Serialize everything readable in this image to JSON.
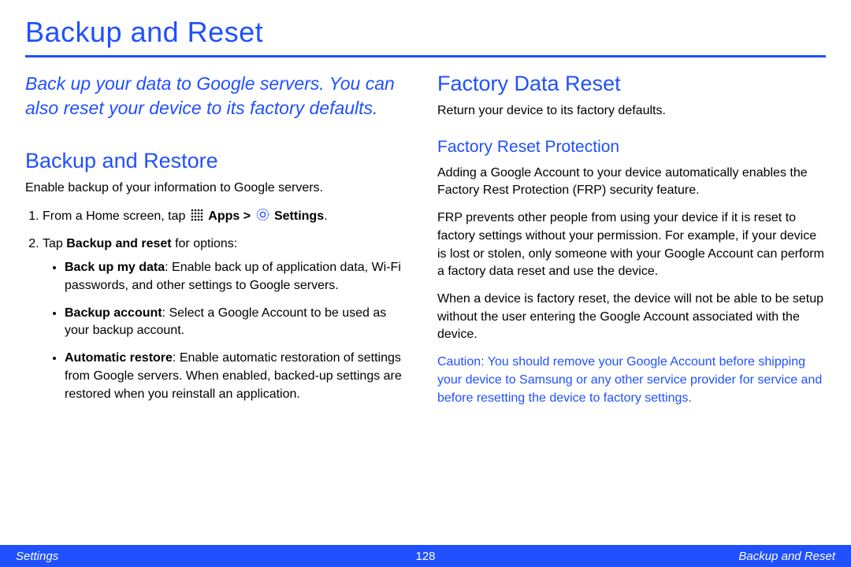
{
  "title": "Backup and Reset",
  "lead": "Back up your data to Google servers. You can also reset your device to its factory defaults.",
  "left": {
    "heading": "Backup and Restore",
    "intro": "Enable backup of your information to Google servers.",
    "step1_prefix": "From a Home screen, tap ",
    "step1_apps": "Apps",
    "step1_gt": " > ",
    "step1_settings": "Settings",
    "step1_suffix": ".",
    "step2_prefix": "Tap ",
    "step2_bold": "Backup and reset",
    "step2_suffix": " for options:",
    "opt1_bold": "Back up my data",
    "opt1_rest": ": Enable back up of application data, Wi-Fi passwords, and other settings to Google servers.",
    "opt2_bold": "Backup account",
    "opt2_rest": ": Select a Google Account to be used as your backup account.",
    "opt3_bold": "Automatic restore",
    "opt3_rest": ": Enable automatic restoration of settings from Google servers. When enabled, backed-up settings are restored when you reinstall an application."
  },
  "right": {
    "heading": "Factory Data Reset",
    "intro": "Return your device to its factory defaults.",
    "sub": "Factory Reset Protection",
    "p1": "Adding a Google Account to your device automatically enables the Factory Rest Protection (FRP) security feature.",
    "p2": "FRP prevents other people from using your device if it is reset to factory settings without your permission. For example, if your device is lost or stolen, only someone with your Google Account can perform a factory data reset and use the device.",
    "p3": "When a device is factory reset, the device will not be able to be setup without the user entering the Google Account associated with the device.",
    "caution_label": "Caution",
    "caution_rest": ": You should remove your Google Account before shipping your device to Samsung or any other service provider for service and before resetting the device to factory settings."
  },
  "footer": {
    "left": "Settings",
    "page": "128",
    "right": "Backup and Reset"
  }
}
